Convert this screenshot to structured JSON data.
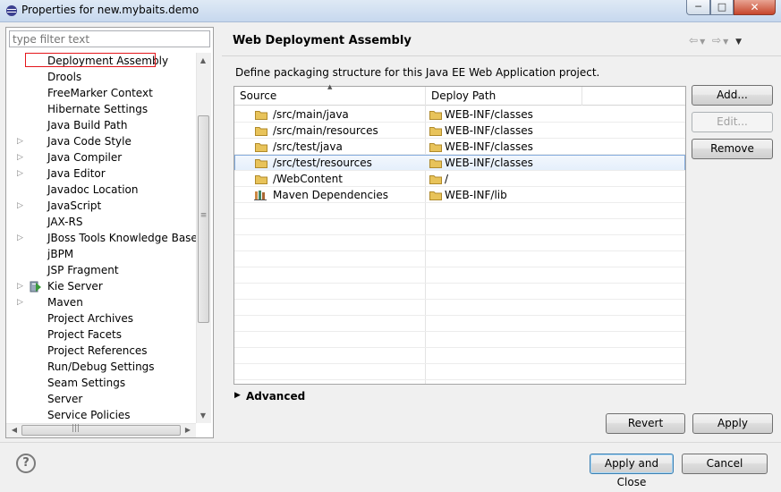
{
  "window": {
    "title": "Properties for new.mybaits.demo"
  },
  "filter": {
    "placeholder": "type filter text"
  },
  "tree": {
    "items": [
      {
        "label": "Deployment Assembly",
        "expandable": false,
        "selected": true
      },
      {
        "label": "Drools",
        "expandable": false
      },
      {
        "label": "FreeMarker Context",
        "expandable": false
      },
      {
        "label": "Hibernate Settings",
        "expandable": false
      },
      {
        "label": "Java Build Path",
        "expandable": false
      },
      {
        "label": "Java Code Style",
        "expandable": true
      },
      {
        "label": "Java Compiler",
        "expandable": true
      },
      {
        "label": "Java Editor",
        "expandable": true
      },
      {
        "label": "Javadoc Location",
        "expandable": false
      },
      {
        "label": "JavaScript",
        "expandable": true
      },
      {
        "label": "JAX-RS",
        "expandable": false
      },
      {
        "label": "JBoss Tools Knowledge Base",
        "expandable": true
      },
      {
        "label": "jBPM",
        "expandable": false
      },
      {
        "label": "JSP Fragment",
        "expandable": false
      },
      {
        "label": "Kie Server",
        "expandable": true,
        "icon": "kie-server-icon"
      },
      {
        "label": "Maven",
        "expandable": true
      },
      {
        "label": "Project Archives",
        "expandable": false
      },
      {
        "label": "Project Facets",
        "expandable": false
      },
      {
        "label": "Project References",
        "expandable": false
      },
      {
        "label": "Run/Debug Settings",
        "expandable": false
      },
      {
        "label": "Seam Settings",
        "expandable": false
      },
      {
        "label": "Server",
        "expandable": false
      },
      {
        "label": "Service Policies",
        "expandable": false
      }
    ]
  },
  "page": {
    "title": "Web Deployment Assembly",
    "description": "Define packaging structure for this Java EE Web Application project."
  },
  "table": {
    "headers": [
      "Source",
      "Deploy Path"
    ],
    "rows": [
      {
        "source": "/src/main/java",
        "deploy": "WEB-INF/classes",
        "icon": "folder-icon"
      },
      {
        "source": "/src/main/resources",
        "deploy": "WEB-INF/classes",
        "icon": "folder-icon"
      },
      {
        "source": "/src/test/java",
        "deploy": "WEB-INF/classes",
        "icon": "folder-icon"
      },
      {
        "source": "/src/test/resources",
        "deploy": "WEB-INF/classes",
        "icon": "folder-icon",
        "selected": true
      },
      {
        "source": "/WebContent",
        "deploy": "/",
        "icon": "folder-icon"
      },
      {
        "source": "Maven Dependencies",
        "deploy": "WEB-INF/lib",
        "icon": "library-icon"
      }
    ]
  },
  "buttons": {
    "add": "Add...",
    "edit": "Edit...",
    "remove": "Remove",
    "revert": "Revert",
    "apply": "Apply",
    "apply_close": "Apply and Close",
    "cancel": "Cancel"
  },
  "advanced": {
    "label": "Advanced"
  },
  "colors": {
    "selection_border": "#84acdd",
    "highlight_box": "#e4161b",
    "folder": "#e8c35a"
  }
}
